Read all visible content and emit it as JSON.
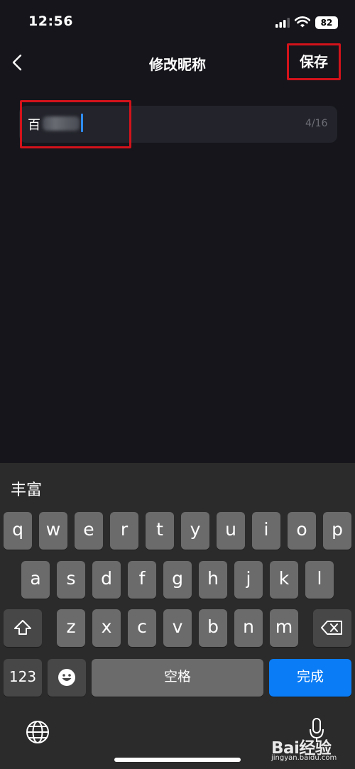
{
  "status_bar": {
    "time": "12:56",
    "battery": "82"
  },
  "nav": {
    "title": "修改昵称",
    "save_label": "保存"
  },
  "nickname_field": {
    "value": "百",
    "counter": "4/16"
  },
  "keyboard": {
    "candidate": "丰富",
    "rows": [
      [
        "q",
        "w",
        "e",
        "r",
        "t",
        "y",
        "u",
        "i",
        "o",
        "p"
      ],
      [
        "a",
        "s",
        "d",
        "f",
        "g",
        "h",
        "j",
        "k",
        "l"
      ],
      [
        "z",
        "x",
        "c",
        "v",
        "b",
        "n",
        "m"
      ]
    ],
    "numbers_label": "123",
    "space_label": "空格",
    "done_label": "完成",
    "accent_color": "#0a7cf5"
  },
  "watermark": {
    "brand": "Bai经验",
    "url": "jingyan.baidu.com"
  },
  "highlight_color": "#d3121a"
}
